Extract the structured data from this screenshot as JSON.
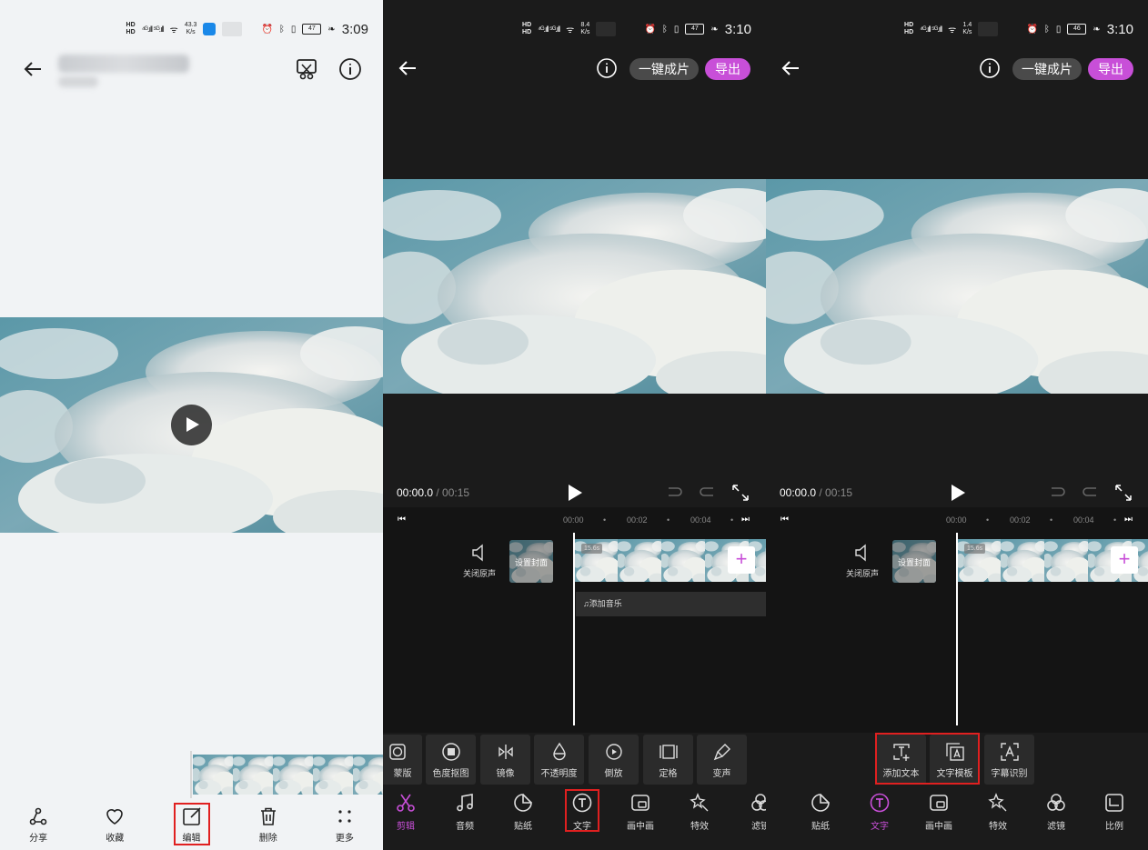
{
  "colors": {
    "accent": "#c84fd8",
    "highlight_box": "#e02020"
  },
  "panel1": {
    "status": {
      "speed": "43.3",
      "speed_unit": "K/s",
      "time": "3:09",
      "battery": "47"
    },
    "bottom_bar": [
      {
        "label": "分享",
        "icon": "share-icon"
      },
      {
        "label": "收藏",
        "icon": "heart-icon"
      },
      {
        "label": "编辑",
        "icon": "edit-icon"
      },
      {
        "label": "删除",
        "icon": "trash-icon"
      },
      {
        "label": "更多",
        "icon": "more-icon"
      }
    ]
  },
  "panel2": {
    "status": {
      "speed": "8.4",
      "speed_unit": "K/s",
      "time": "3:10",
      "battery": "47"
    },
    "header": {
      "one_click": "一键成片",
      "export": "导出"
    },
    "timecode": {
      "current": "00:00.0",
      "total": " / 00:15"
    },
    "ruler": [
      "00:00",
      "00:02",
      "00:04"
    ],
    "mute_label": "关闭原声",
    "cover_label": "设置封面",
    "clip_duration": "15.6s",
    "music_label": "♫添加音乐",
    "tools": [
      {
        "label": "蒙版",
        "icon": "mask-icon"
      },
      {
        "label": "色度抠图",
        "icon": "chroma-key-icon"
      },
      {
        "label": "镜像",
        "icon": "mirror-icon"
      },
      {
        "label": "不透明度",
        "icon": "opacity-icon"
      },
      {
        "label": "倒放",
        "icon": "reverse-icon"
      },
      {
        "label": "定格",
        "icon": "freeze-icon"
      },
      {
        "label": "变声",
        "icon": "voice-change-icon"
      }
    ],
    "tabs": [
      {
        "label": "剪辑",
        "icon": "scissors-icon"
      },
      {
        "label": "音频",
        "icon": "music-icon"
      },
      {
        "label": "贴纸",
        "icon": "sticker-icon"
      },
      {
        "label": "文字",
        "icon": "text-icon"
      },
      {
        "label": "画中画",
        "icon": "pip-icon"
      },
      {
        "label": "特效",
        "icon": "effects-icon"
      },
      {
        "label": "滤镜",
        "icon": "filter-icon"
      }
    ]
  },
  "panel3": {
    "status": {
      "speed": "1.4",
      "speed_unit": "K/s",
      "time": "3:10",
      "battery": "46"
    },
    "header": {
      "one_click": "一键成片",
      "export": "导出"
    },
    "timecode": {
      "current": "00:00.0",
      "total": " / 00:15"
    },
    "ruler": [
      "00:00",
      "00:02",
      "00:04"
    ],
    "mute_label": "关闭原声",
    "cover_label": "设置封面",
    "clip_duration": "15.6s",
    "tools": [
      {
        "label": "添加文本",
        "icon": "add-text-icon"
      },
      {
        "label": "文字模板",
        "icon": "text-template-icon"
      },
      {
        "label": "字幕识别",
        "icon": "subtitle-recognition-icon"
      }
    ],
    "tabs": [
      {
        "label": "贴纸",
        "icon": "sticker-icon"
      },
      {
        "label": "文字",
        "icon": "text-icon"
      },
      {
        "label": "画中画",
        "icon": "pip-icon"
      },
      {
        "label": "特效",
        "icon": "effects-icon"
      },
      {
        "label": "滤镜",
        "icon": "filter-icon"
      },
      {
        "label": "比例",
        "icon": "ratio-icon"
      }
    ]
  }
}
